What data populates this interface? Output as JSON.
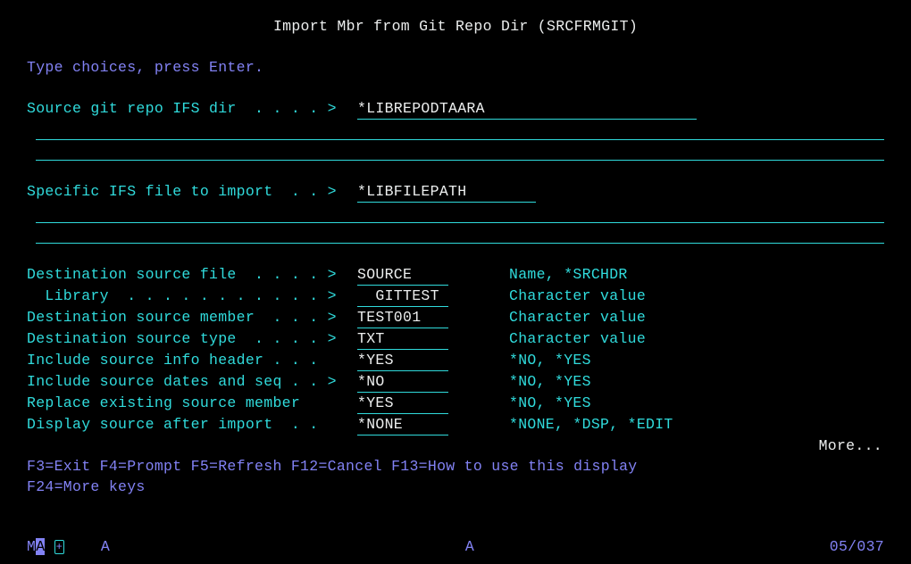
{
  "title": "Import Mbr from Git Repo Dir (SRCFRMGIT)",
  "instruction": "Type choices, press Enter.",
  "fields": {
    "repoDir": {
      "label": "Source git repo IFS dir  . . . . >",
      "value": "*LIBREPODTAARA"
    },
    "ifsFile": {
      "label": "Specific IFS file to import  . . >",
      "value": "*LIBFILEPATH"
    },
    "srcFile": {
      "label": "Destination source file  . . . . >",
      "value": "SOURCE    ",
      "hint": "Name, *SRCHDR"
    },
    "library": {
      "label": "  Library  . . . . . . . . . . . >",
      "value": "  GITTEST ",
      "hint": "Character value"
    },
    "srcMbr": {
      "label": "Destination source member  . . . >",
      "value": "TEST001   ",
      "hint": "Character value"
    },
    "srcType": {
      "label": "Destination source type  . . . . >",
      "value": "TXT       ",
      "hint": "Character value"
    },
    "infoHdr": {
      "label": "Include source info header . . .  ",
      "value": "*YES      ",
      "hint": "*NO, *YES"
    },
    "datesSeq": {
      "label": "Include source dates and seq . . >",
      "value": "*NO       ",
      "hint": "*NO, *YES"
    },
    "replace": {
      "label": "Replace existing source member    ",
      "value": "*YES      ",
      "hint": "*NO, *YES"
    },
    "dspAfter": {
      "label": "Display source after import  . .  ",
      "value": "*NONE     ",
      "hint": "*NONE, *DSP, *EDIT"
    }
  },
  "more": "More...",
  "fkeys1": "F3=Exit   F4=Prompt   F5=Refresh   F12=Cancel   F13=How to use this display",
  "fkeys2": "F24=More keys",
  "status": {
    "left_pre": "M",
    "left_cursor": "A",
    "left_post": "    A",
    "center": "A",
    "pos": "05/037"
  }
}
